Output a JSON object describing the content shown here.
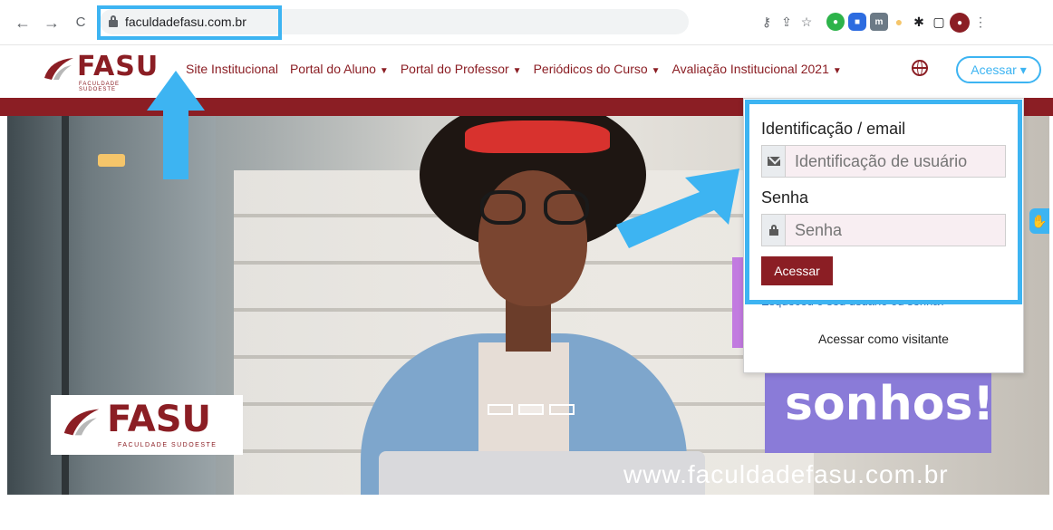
{
  "browser": {
    "back_icon": "←",
    "forward_icon": "→",
    "reload_icon": "C",
    "url": "faculdadefasu.com.br"
  },
  "site": {
    "logo_text": "FASU",
    "logo_sub": "FACULDADE SUDOESTE",
    "menu": [
      {
        "label": "Site Institucional",
        "dropdown": false
      },
      {
        "label": "Portal do Aluno",
        "dropdown": true
      },
      {
        "label": "Portal do Professor",
        "dropdown": true
      },
      {
        "label": "Periódicos do Curso",
        "dropdown": true
      },
      {
        "label": "Avaliação Institucional 2021",
        "dropdown": true
      }
    ],
    "login_button": "Acessar ▾",
    "brand_color": "#8b1e24",
    "highlight_color": "#3db4f2"
  },
  "hero": {
    "headline": "sonhos!",
    "website": "www.faculdadefasu.com.br",
    "logo_text": "FASU",
    "logo_sub": "FACULDADE SUDOESTE",
    "carousel_active_index": 1,
    "accessibility_icon": "hand-icon"
  },
  "login": {
    "username_label": "Identificação / email",
    "username_placeholder": "Identificação de usuário",
    "password_label": "Senha",
    "password_placeholder": "Senha",
    "submit_label": "Acessar",
    "forgot_label": "Esqueceu o seu usuário ou senha?",
    "guest_label": "Acessar como visitante"
  }
}
